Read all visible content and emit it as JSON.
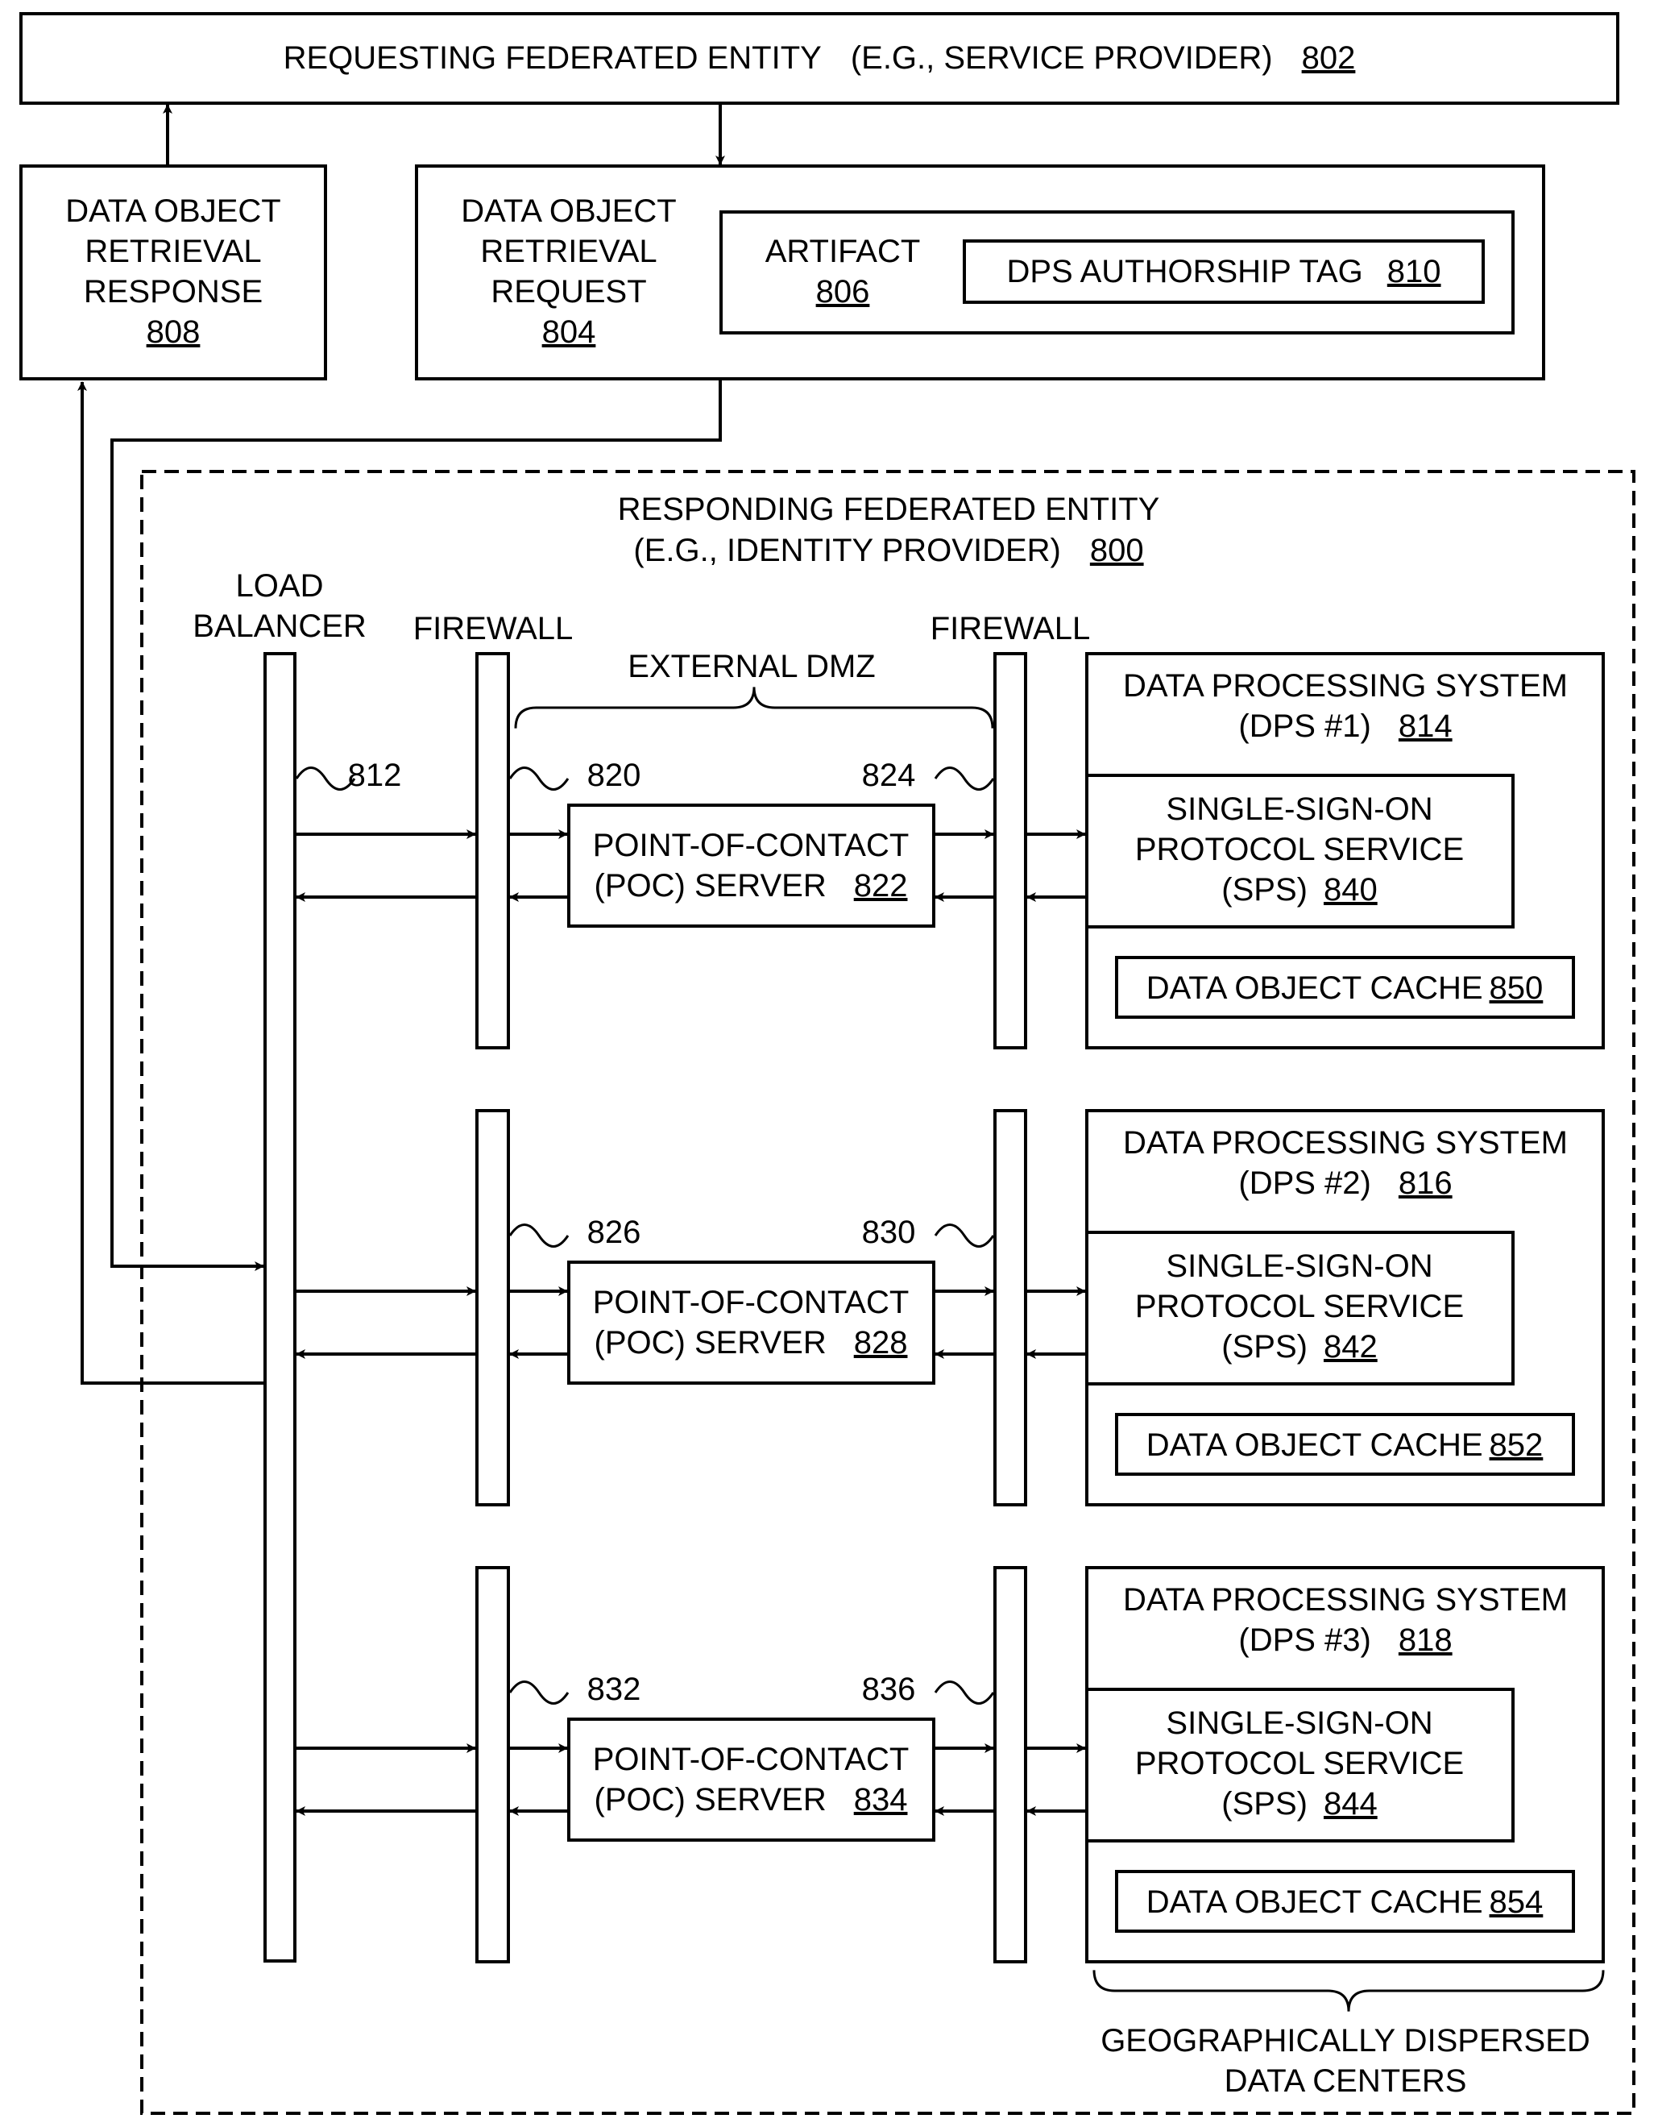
{
  "figure": {
    "requesting_entity": {
      "label": "REQUESTING FEDERATED ENTITY",
      "example": "(E.G., SERVICE PROVIDER)",
      "ref": "802"
    },
    "retrieval_response": {
      "lines": [
        "DATA OBJECT",
        "RETRIEVAL",
        "RESPONSE"
      ],
      "ref": "808"
    },
    "retrieval_request": {
      "lines": [
        "DATA OBJECT",
        "RETRIEVAL",
        "REQUEST"
      ],
      "ref": "804"
    },
    "artifact": {
      "label": "ARTIFACT",
      "ref": "806"
    },
    "authorship_tag": {
      "label": "DPS AUTHORSHIP TAG",
      "ref": "810"
    },
    "responding_entity": {
      "line1": "RESPONDING FEDERATED ENTITY",
      "line2": "(E.G., IDENTITY PROVIDER)",
      "ref": "800"
    },
    "load_balancer": {
      "lines": [
        "LOAD",
        "BALANCER"
      ],
      "ref": "812"
    },
    "firewall_label": "FIREWALL",
    "external_dmz": "EXTERNAL DMZ",
    "rows": [
      {
        "fw1_ref": "820",
        "fw2_ref": "824",
        "poc_lines": [
          "POINT-OF-CONTACT",
          "(POC) SERVER"
        ],
        "poc_ref": "822",
        "dps_lines": [
          "DATA PROCESSING SYSTEM",
          "(DPS #1)"
        ],
        "dps_ref": "814",
        "sps_lines": [
          "SINGLE-SIGN-ON",
          "PROTOCOL SERVICE",
          "(SPS)"
        ],
        "sps_ref": "840",
        "cache_label": "DATA OBJECT CACHE",
        "cache_ref": "850"
      },
      {
        "fw1_ref": "826",
        "fw2_ref": "830",
        "poc_lines": [
          "POINT-OF-CONTACT",
          "(POC) SERVER"
        ],
        "poc_ref": "828",
        "dps_lines": [
          "DATA PROCESSING SYSTEM",
          "(DPS #2)"
        ],
        "dps_ref": "816",
        "sps_lines": [
          "SINGLE-SIGN-ON",
          "PROTOCOL SERVICE",
          "(SPS)"
        ],
        "sps_ref": "842",
        "cache_label": "DATA OBJECT CACHE",
        "cache_ref": "852"
      },
      {
        "fw1_ref": "832",
        "fw2_ref": "836",
        "poc_lines": [
          "POINT-OF-CONTACT",
          "(POC) SERVER"
        ],
        "poc_ref": "834",
        "dps_lines": [
          "DATA PROCESSING SYSTEM",
          "(DPS #3)"
        ],
        "dps_ref": "818",
        "sps_lines": [
          "SINGLE-SIGN-ON",
          "PROTOCOL SERVICE",
          "(SPS)"
        ],
        "sps_ref": "844",
        "cache_label": "DATA OBJECT CACHE",
        "cache_ref": "854"
      }
    ],
    "dispersed_caption": [
      "GEOGRAPHICALLY DISPERSED",
      "DATA CENTERS"
    ]
  }
}
